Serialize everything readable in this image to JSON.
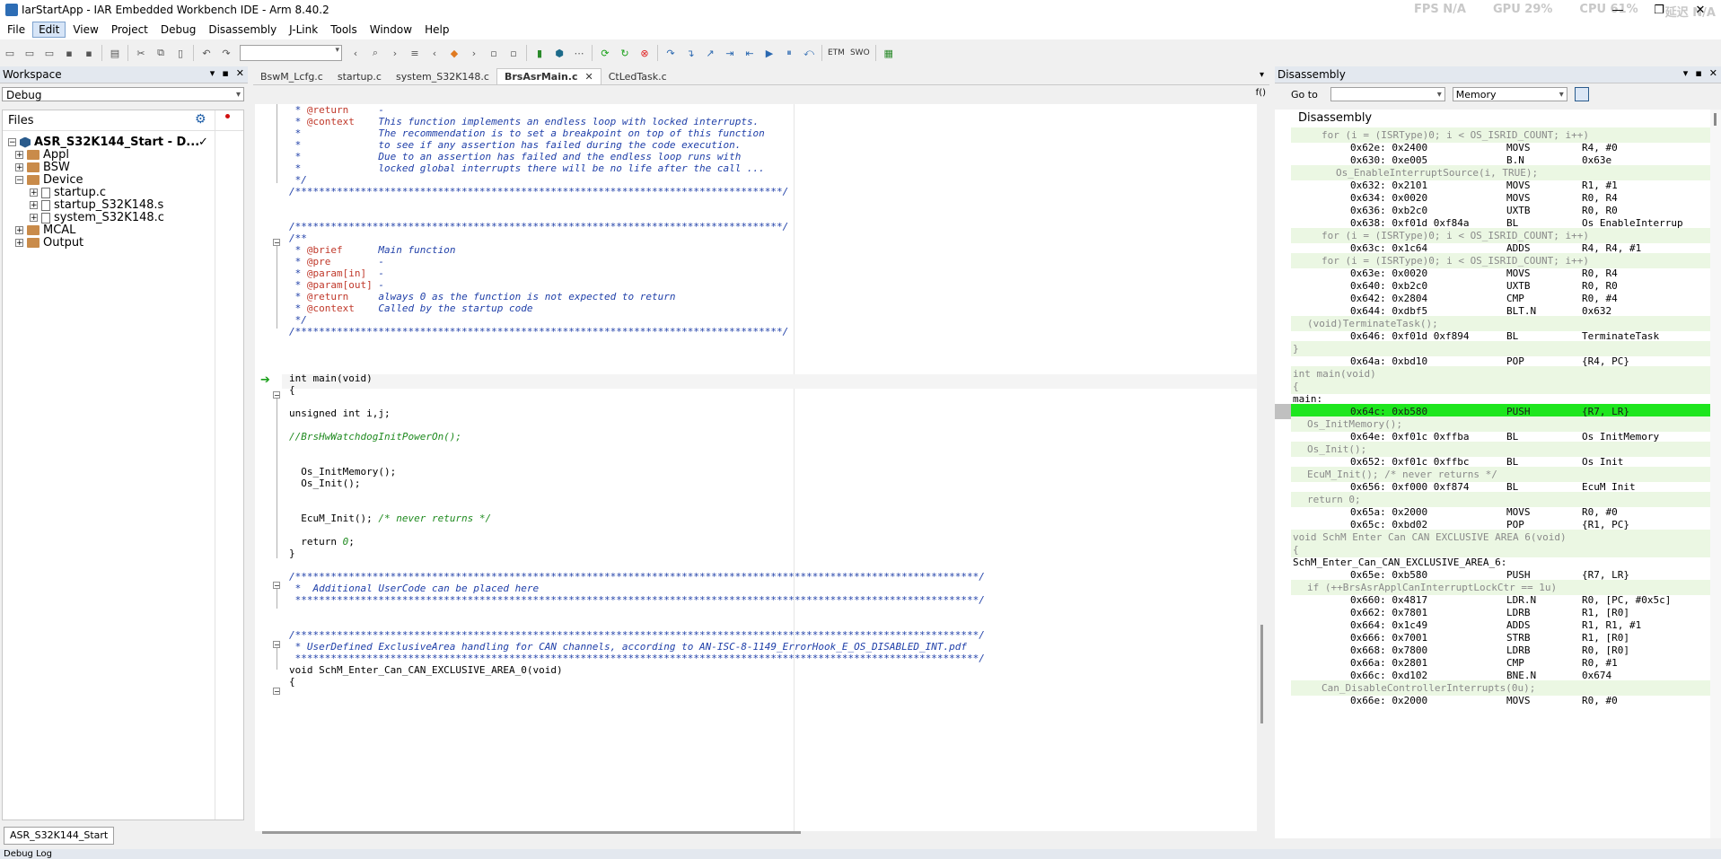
{
  "window": {
    "title": "IarStartApp - IAR Embedded Workbench IDE - Arm 8.40.2",
    "overlay": [
      "FPS N/A",
      "GPU 29%",
      "CPU 61%",
      "延迟 N/A"
    ],
    "controls": [
      "—",
      "❐",
      "✕"
    ]
  },
  "menu": [
    "File",
    "Edit",
    "View",
    "Project",
    "Debug",
    "Disassembly",
    "J-Link",
    "Tools",
    "Window",
    "Help"
  ],
  "toolbar": {
    "etm": "ETM",
    "swo": "SWO"
  },
  "workspace": {
    "title": "Workspace",
    "config": "Debug",
    "files_header": "Files",
    "project": "ASR_S32K144_Start - D...",
    "project_check": "✓",
    "tree": [
      {
        "label": "Appl",
        "type": "folder",
        "level": 1,
        "exp": "+"
      },
      {
        "label": "BSW",
        "type": "folder",
        "level": 1,
        "exp": "+"
      },
      {
        "label": "Device",
        "type": "folder",
        "level": 1,
        "exp": "−"
      },
      {
        "label": "startup.c",
        "type": "file",
        "level": 2,
        "exp": "+"
      },
      {
        "label": "startup_S32K148.s",
        "type": "file",
        "level": 2,
        "exp": "+"
      },
      {
        "label": "system_S32K148.c",
        "type": "file",
        "level": 2,
        "exp": "+"
      },
      {
        "label": "MCAL",
        "type": "folder",
        "level": 1,
        "exp": "+"
      },
      {
        "label": "Output",
        "type": "folder",
        "level": 1,
        "exp": "+"
      }
    ],
    "bottom_tab": "ASR_S32K144_Start"
  },
  "editor": {
    "tabs": [
      "BswM_Lcfg.c",
      "startup.c",
      "system_S32K148.c",
      "BrsAsrMain.c",
      "CtLedTask.c"
    ],
    "active_tab": "BrsAsrMain.c",
    "fx": "f()",
    "lines": [
      [
        {
          "c": "cm",
          "t": " * "
        },
        {
          "c": "tag",
          "t": "@return"
        },
        {
          "c": "cm",
          "t": "     -"
        }
      ],
      [
        {
          "c": "cm",
          "t": " * "
        },
        {
          "c": "tag",
          "t": "@context"
        },
        {
          "c": "cm",
          "t": "    This function implements an endless loop with locked interrupts."
        }
      ],
      [
        {
          "c": "cm",
          "t": " *             The recommendation is to set a breakpoint on top of this function"
        }
      ],
      [
        {
          "c": "cm",
          "t": " *             to see if any assertion has failed during the code execution."
        }
      ],
      [
        {
          "c": "cm",
          "t": " *             Due to an assertion has failed and the endless loop runs with"
        }
      ],
      [
        {
          "c": "cm",
          "t": " *             locked global interrupts there will be no life after the call ..."
        }
      ],
      [
        {
          "c": "cm",
          "t": " */"
        }
      ],
      [
        {
          "c": "cm",
          "t": "/**********************************************************************************/"
        }
      ],
      [],
      [],
      [
        {
          "c": "cm",
          "t": "/**********************************************************************************/"
        }
      ],
      [
        {
          "c": "cm",
          "t": "/**"
        }
      ],
      [
        {
          "c": "cm",
          "t": " * "
        },
        {
          "c": "tag",
          "t": "@brief"
        },
        {
          "c": "cm",
          "t": "      Main function"
        }
      ],
      [
        {
          "c": "cm",
          "t": " * "
        },
        {
          "c": "tag",
          "t": "@pre"
        },
        {
          "c": "cm",
          "t": "        -"
        }
      ],
      [
        {
          "c": "cm",
          "t": " * "
        },
        {
          "c": "tag",
          "t": "@param[in]"
        },
        {
          "c": "cm",
          "t": "  -"
        }
      ],
      [
        {
          "c": "cm",
          "t": " * "
        },
        {
          "c": "tag",
          "t": "@param[out]"
        },
        {
          "c": "cm",
          "t": " -"
        }
      ],
      [
        {
          "c": "cm",
          "t": " * "
        },
        {
          "c": "tag",
          "t": "@return"
        },
        {
          "c": "cm",
          "t": "     always 0 as the function is not expected to return"
        }
      ],
      [
        {
          "c": "cm",
          "t": " * "
        },
        {
          "c": "tag",
          "t": "@context"
        },
        {
          "c": "cm",
          "t": "    Called by the startup code"
        }
      ],
      [
        {
          "c": "cm",
          "t": " */"
        }
      ],
      [
        {
          "c": "cm",
          "t": "/**********************************************************************************/"
        }
      ],
      [],
      [],
      [],
      [
        {
          "c": "kw",
          "t": "int main(void)"
        }
      ],
      [
        {
          "c": "kw",
          "t": "{"
        }
      ],
      [],
      [
        {
          "c": "kw",
          "t": "unsigned int i,j;"
        }
      ],
      [],
      [
        {
          "c": "gr",
          "t": "//BrsHwWatchdogInitPowerOn();"
        }
      ],
      [],
      [],
      [
        {
          "c": "kw",
          "t": "  Os_InitMemory();"
        }
      ],
      [
        {
          "c": "kw",
          "t": "  Os_Init();"
        }
      ],
      [],
      [],
      [
        {
          "c": "kw",
          "t": "  EcuM_Init(); "
        },
        {
          "c": "gr",
          "t": "/* never returns */"
        }
      ],
      [],
      [
        {
          "c": "kw",
          "t": "  return "
        },
        {
          "c": "gr",
          "t": "0"
        },
        {
          "c": "kw",
          "t": ";"
        }
      ],
      [
        {
          "c": "kw",
          "t": "}"
        }
      ],
      [],
      [
        {
          "c": "cm",
          "t": "/*******************************************************************************************************************/"
        }
      ],
      [
        {
          "c": "cm",
          "t": " *  Additional UserCode can be placed here"
        }
      ],
      [
        {
          "c": "cm",
          "t": " *******************************************************************************************************************/"
        }
      ],
      [],
      [],
      [
        {
          "c": "cm",
          "t": "/*******************************************************************************************************************/"
        }
      ],
      [
        {
          "c": "cm",
          "t": " * UserDefined ExclusiveArea handling for CAN channels, according to AN-ISC-8-1149_ErrorHook_E_OS_DISABLED_INT.pdf"
        }
      ],
      [
        {
          "c": "cm",
          "t": " *******************************************************************************************************************/"
        }
      ],
      [
        {
          "c": "kw",
          "t": "void SchM_Enter_Can_CAN_EXCLUSIVE_AREA_0(void)"
        }
      ],
      [
        {
          "c": "kw",
          "t": "{"
        }
      ]
    ]
  },
  "disassembly": {
    "title": "Disassembly",
    "goto_label": "Go to",
    "memory": "Memory",
    "header": "Disassembly",
    "lines": [
      {
        "k": "src",
        "i": 4,
        "t": "for (i = (ISRType)0; i < OS_ISRID_COUNT; i++)"
      },
      {
        "k": "ins",
        "a": "0x62e: 0x2400",
        "o": "MOVS",
        "g": "R4, #0"
      },
      {
        "k": "ins",
        "a": "0x630: 0xe005",
        "o": "B.N",
        "g": "0x63e"
      },
      {
        "k": "src",
        "i": 6,
        "t": "Os_EnableInterruptSource(i, TRUE);"
      },
      {
        "k": "ins",
        "a": "0x632: 0x2101",
        "o": "MOVS",
        "g": "R1, #1"
      },
      {
        "k": "ins",
        "a": "0x634: 0x0020",
        "o": "MOVS",
        "g": "R0, R4"
      },
      {
        "k": "ins",
        "a": "0x636: 0xb2c0",
        "o": "UXTB",
        "g": "R0, R0"
      },
      {
        "k": "ins",
        "a": "0x638: 0xf01d 0xf84a",
        "o": "BL",
        "g": "Os_EnableInterrup"
      },
      {
        "k": "src",
        "i": 4,
        "t": "for (i = (ISRType)0; i < OS_ISRID_COUNT; i++)"
      },
      {
        "k": "ins",
        "a": "0x63c: 0x1c64",
        "o": "ADDS",
        "g": "R4, R4, #1"
      },
      {
        "k": "src",
        "i": 4,
        "t": "for (i = (ISRType)0; i < OS_ISRID_COUNT; i++)"
      },
      {
        "k": "ins",
        "a": "0x63e: 0x0020",
        "o": "MOVS",
        "g": "R0, R4"
      },
      {
        "k": "ins",
        "a": "0x640: 0xb2c0",
        "o": "UXTB",
        "g": "R0, R0"
      },
      {
        "k": "ins",
        "a": "0x642: 0x2804",
        "o": "CMP",
        "g": "R0, #4"
      },
      {
        "k": "ins",
        "a": "0x644: 0xdbf5",
        "o": "BLT.N",
        "g": "0x632"
      },
      {
        "k": "src",
        "i": 2,
        "t": "(void)TerminateTask();"
      },
      {
        "k": "ins",
        "a": "0x646: 0xf01d 0xf894",
        "o": "BL",
        "g": "TerminateTask"
      },
      {
        "k": "src",
        "i": 0,
        "t": "}"
      },
      {
        "k": "ins",
        "a": "0x64a: 0xbd10",
        "o": "POP",
        "g": "{R4, PC}"
      },
      {
        "k": "src",
        "i": 0,
        "t": "int main(void)"
      },
      {
        "k": "src",
        "i": 0,
        "t": "{"
      },
      {
        "k": "lbl",
        "i": 0,
        "t": "main:"
      },
      {
        "k": "sel",
        "a": "0x64c: 0xb580",
        "o": "PUSH",
        "g": "{R7, LR}"
      },
      {
        "k": "src",
        "i": 2,
        "t": "Os_InitMemory();"
      },
      {
        "k": "ins",
        "a": "0x64e: 0xf01c 0xffba",
        "o": "BL",
        "g": "Os_InitMemory"
      },
      {
        "k": "src",
        "i": 2,
        "t": "Os_Init();"
      },
      {
        "k": "ins",
        "a": "0x652: 0xf01c 0xffbc",
        "o": "BL",
        "g": "Os_Init"
      },
      {
        "k": "src",
        "i": 2,
        "t": "EcuM_Init(); /* never returns */"
      },
      {
        "k": "ins",
        "a": "0x656: 0xf000 0xf874",
        "o": "BL",
        "g": "EcuM_Init"
      },
      {
        "k": "src",
        "i": 2,
        "t": "return 0;"
      },
      {
        "k": "ins",
        "a": "0x65a: 0x2000",
        "o": "MOVS",
        "g": "R0, #0"
      },
      {
        "k": "ins",
        "a": "0x65c: 0xbd02",
        "o": "POP",
        "g": "{R1, PC}"
      },
      {
        "k": "src",
        "i": 0,
        "t": "void SchM_Enter_Can_CAN_EXCLUSIVE_AREA_6(void)"
      },
      {
        "k": "src",
        "i": 0,
        "t": "{"
      },
      {
        "k": "lbl",
        "i": 0,
        "t": "SchM_Enter_Can_CAN_EXCLUSIVE_AREA_6:"
      },
      {
        "k": "ins",
        "a": "0x65e: 0xb580",
        "o": "PUSH",
        "g": "{R7, LR}"
      },
      {
        "k": "src",
        "i": 2,
        "t": "if (++BrsAsrApplCanInterruptLockCtr == 1u)"
      },
      {
        "k": "ins",
        "a": "0x660: 0x4817",
        "o": "LDR.N",
        "g": "R0, [PC, #0x5c]"
      },
      {
        "k": "ins",
        "a": "0x662: 0x7801",
        "o": "LDRB",
        "g": "R1, [R0]"
      },
      {
        "k": "ins",
        "a": "0x664: 0x1c49",
        "o": "ADDS",
        "g": "R1, R1, #1"
      },
      {
        "k": "ins",
        "a": "0x666: 0x7001",
        "o": "STRB",
        "g": "R1, [R0]"
      },
      {
        "k": "ins",
        "a": "0x668: 0x7800",
        "o": "LDRB",
        "g": "R0, [R0]"
      },
      {
        "k": "ins",
        "a": "0x66a: 0x2801",
        "o": "CMP",
        "g": "R0, #1"
      },
      {
        "k": "ins",
        "a": "0x66c: 0xd102",
        "o": "BNE.N",
        "g": "0x674"
      },
      {
        "k": "src",
        "i": 4,
        "t": "Can_DisableControllerInterrupts(0u);"
      },
      {
        "k": "ins",
        "a": "0x66e: 0x2000",
        "o": "MOVS",
        "g": "R0, #0"
      }
    ]
  },
  "bottom": {
    "label": "Debug Log"
  }
}
